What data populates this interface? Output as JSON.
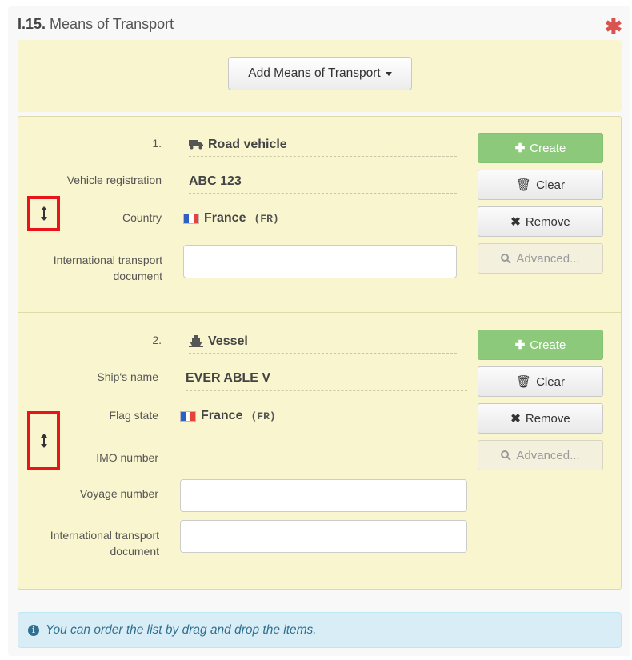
{
  "section": {
    "code": "I.15.",
    "title": "Means of Transport",
    "required_mark": "✱"
  },
  "add_button": {
    "label": "Add Means of Transport"
  },
  "items": [
    {
      "index": "1.",
      "type_icon": "truck-icon",
      "type": "Road vehicle",
      "fields": {
        "vehicle_registration_label": "Vehicle registration",
        "vehicle_registration_value": "ABC 123",
        "country_label": "Country",
        "country_value": "France",
        "country_code": "(FR)",
        "itd_label_line1": "International transport",
        "itd_label_line2": "document",
        "itd_value": ""
      }
    },
    {
      "index": "2.",
      "type_icon": "ship-icon",
      "type": "Vessel",
      "fields": {
        "ship_name_label": "Ship's name",
        "ship_name_value": "EVER ABLE V",
        "flag_state_label": "Flag state",
        "flag_state_value": "France",
        "flag_state_code": "(FR)",
        "imo_label": "IMO number",
        "voyage_label": "Voyage number",
        "voyage_value": "",
        "itd_label_line1": "International transport",
        "itd_label_line2": "document",
        "itd_value": ""
      }
    }
  ],
  "buttons": {
    "create": "Create",
    "clear": "Clear",
    "remove": "Remove",
    "advanced": "Advanced..."
  },
  "info": {
    "text": "You can order the list by drag and drop the items."
  },
  "colors": {
    "required": "#d9534f",
    "create_button": "#8cc97a",
    "item_background": "#f8f5cf",
    "drag_highlight": "#e8141a",
    "info_background": "#d9edf7",
    "flag_blue": "#2f5fc4",
    "flag_white": "#ffffff",
    "flag_red": "#e8413a"
  }
}
